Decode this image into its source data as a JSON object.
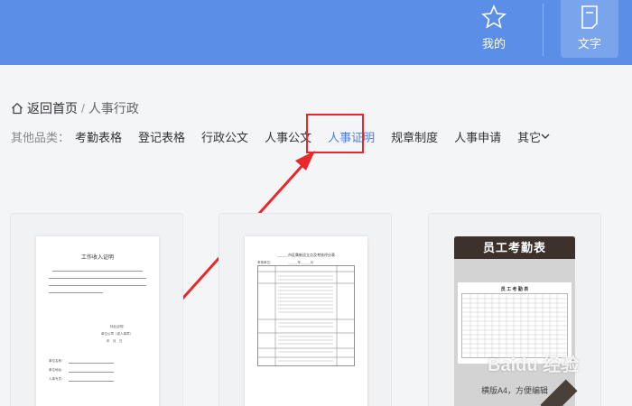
{
  "header": {
    "nav": [
      {
        "label": "我的",
        "icon": "star-icon"
      },
      {
        "label": "文字",
        "icon": "document-icon"
      }
    ]
  },
  "breadcrumb": {
    "home": "返回首页",
    "separator": "/",
    "current": "人事行政"
  },
  "categories": {
    "label": "其他品类：",
    "items": [
      "考勤表格",
      "登记表格",
      "行政公文",
      "人事公文",
      "人事证明",
      "规章制度",
      "人事申请",
      "其它"
    ],
    "active_index": 4
  },
  "cards": [
    {
      "doc_title": "工作收入证明",
      "lines": [
        "特此证明！",
        "单位公章（或人事章）",
        "年　月　日",
        "单位名称：",
        "单位地址：",
        "人事专员："
      ]
    },
    {
      "doc_title": "______市区属新设立点及考核评分表",
      "lines": [
        "考核单位：",
        "______年______月"
      ]
    },
    {
      "banner": "员工考勤表",
      "sheet_title": "员 工 考 勤 表",
      "sub": "横版A4，方便编辑"
    }
  ],
  "watermark": "Baidu 经验",
  "colors": {
    "header_bg": "#5b8ee6",
    "active_category": "#4a7fe0",
    "annotation": "#e8282b"
  }
}
